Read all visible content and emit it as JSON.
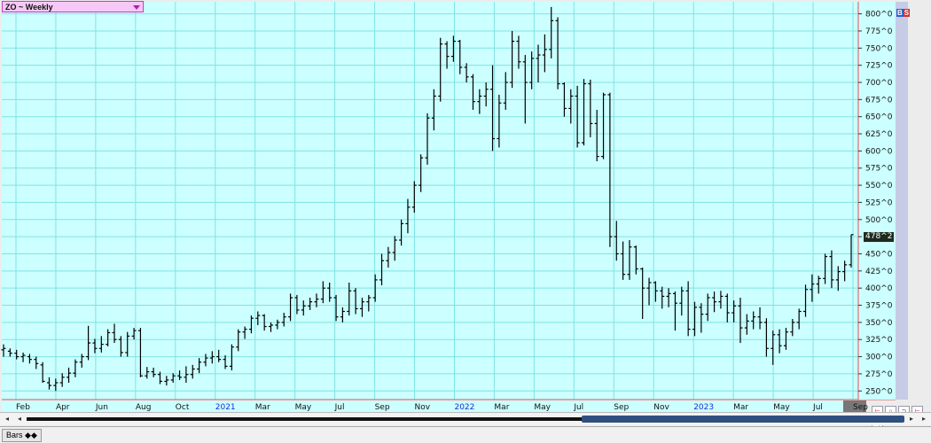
{
  "header": {
    "symbol_label": "ZO ~ Weekly"
  },
  "badges": {
    "b": "B",
    "s": "S"
  },
  "last_price_label": "478^2",
  "bottom": {
    "tab_label": "Bars",
    "tab_glyph": "◆◆"
  },
  "scroll": {
    "left_glyph": "◂",
    "left_glyph2": "◂",
    "right_glyph": "▸",
    "far_right_glyph": "▸"
  },
  "tools": [
    "⊢",
    "∩",
    "⊃",
    "⊢",
    "⊣"
  ],
  "colors": {
    "plot_bg": "#ccffff",
    "grid": "#7fe3e3",
    "bar": "#000000",
    "axis_line": "#e05050",
    "year_label": "#1a2fd0"
  },
  "chart_data": {
    "type": "ohlc",
    "series": [
      {
        "name": "ZO ~ Weekly",
        "values": []
      }
    ],
    "ylim": [
      240,
      815
    ],
    "y_ticks": [
      250,
      275,
      300,
      325,
      350,
      375,
      400,
      425,
      450,
      475,
      500,
      525,
      550,
      575,
      600,
      625,
      650,
      675,
      700,
      725,
      750,
      775,
      800
    ],
    "y_tick_labels": [
      "250^0",
      "275^0",
      "300^0",
      "325^0",
      "350^0",
      "375^0",
      "400^0",
      "425^0",
      "450^0",
      "475^0",
      "500^0",
      "525^0",
      "550^0",
      "575^0",
      "600^0",
      "625^0",
      "650^0",
      "675^0",
      "700^0",
      "725^0",
      "750^0",
      "775^0",
      "800^0"
    ],
    "x_labels": [
      {
        "label": "Feb",
        "year": false
      },
      {
        "label": "Apr",
        "year": false
      },
      {
        "label": "Jun",
        "year": false
      },
      {
        "label": "Aug",
        "year": false
      },
      {
        "label": "Oct",
        "year": false
      },
      {
        "label": "2021",
        "year": true
      },
      {
        "label": "Mar",
        "year": false
      },
      {
        "label": "May",
        "year": false
      },
      {
        "label": "Jul",
        "year": false
      },
      {
        "label": "Sep",
        "year": false
      },
      {
        "label": "Nov",
        "year": false
      },
      {
        "label": "2022",
        "year": true
      },
      {
        "label": "Mar",
        "year": false
      },
      {
        "label": "May",
        "year": false
      },
      {
        "label": "Jul",
        "year": false
      },
      {
        "label": "Sep",
        "year": false
      },
      {
        "label": "Nov",
        "year": false
      },
      {
        "label": "2023",
        "year": true
      },
      {
        "label": "Mar",
        "year": false
      },
      {
        "label": "May",
        "year": false
      },
      {
        "label": "Jul",
        "year": false
      },
      {
        "label": "Sep",
        "year": false
      }
    ],
    "bars": [
      [
        310,
        318,
        300,
        312
      ],
      [
        308,
        312,
        300,
        305
      ],
      [
        305,
        310,
        296,
        300
      ],
      [
        300,
        306,
        292,
        302
      ],
      [
        300,
        304,
        290,
        296
      ],
      [
        296,
        300,
        282,
        290
      ],
      [
        288,
        292,
        262,
        264
      ],
      [
        262,
        270,
        252,
        258
      ],
      [
        258,
        268,
        250,
        262
      ],
      [
        262,
        276,
        256,
        270
      ],
      [
        270,
        284,
        262,
        276
      ],
      [
        276,
        296,
        270,
        292
      ],
      [
        292,
        304,
        284,
        300
      ],
      [
        300,
        345,
        295,
        320
      ],
      [
        320,
        326,
        305,
        312
      ],
      [
        312,
        330,
        306,
        318
      ],
      [
        318,
        340,
        315,
        335
      ],
      [
        335,
        348,
        320,
        325
      ],
      [
        325,
        330,
        300,
        306
      ],
      [
        306,
        336,
        300,
        330
      ],
      [
        330,
        342,
        325,
        338
      ],
      [
        338,
        342,
        270,
        272
      ],
      [
        272,
        285,
        268,
        278
      ],
      [
        278,
        284,
        270,
        274
      ],
      [
        274,
        278,
        260,
        264
      ],
      [
        264,
        272,
        258,
        266
      ],
      [
        266,
        276,
        262,
        272
      ],
      [
        272,
        280,
        266,
        270
      ],
      [
        270,
        286,
        262,
        274
      ],
      [
        274,
        288,
        268,
        282
      ],
      [
        282,
        298,
        276,
        292
      ],
      [
        292,
        304,
        286,
        298
      ],
      [
        298,
        308,
        290,
        300
      ],
      [
        300,
        310,
        292,
        296
      ],
      [
        296,
        302,
        282,
        286
      ],
      [
        286,
        318,
        280,
        314
      ],
      [
        314,
        340,
        308,
        336
      ],
      [
        336,
        344,
        326,
        340
      ],
      [
        340,
        360,
        334,
        356
      ],
      [
        356,
        366,
        346,
        360
      ],
      [
        360,
        362,
        338,
        344
      ],
      [
        344,
        350,
        336,
        346
      ],
      [
        346,
        354,
        340,
        350
      ],
      [
        350,
        364,
        344,
        358
      ],
      [
        358,
        392,
        352,
        386
      ],
      [
        386,
        390,
        362,
        368
      ],
      [
        368,
        382,
        360,
        374
      ],
      [
        374,
        386,
        368,
        380
      ],
      [
        380,
        392,
        372,
        384
      ],
      [
        384,
        410,
        378,
        400
      ],
      [
        400,
        408,
        380,
        386
      ],
      [
        386,
        390,
        352,
        358
      ],
      [
        358,
        372,
        350,
        366
      ],
      [
        366,
        408,
        360,
        396
      ],
      [
        396,
        400,
        362,
        370
      ],
      [
        370,
        386,
        358,
        380
      ],
      [
        380,
        390,
        366,
        386
      ],
      [
        386,
        420,
        380,
        412
      ],
      [
        412,
        450,
        404,
        440
      ],
      [
        440,
        460,
        430,
        452
      ],
      [
        452,
        476,
        440,
        470
      ],
      [
        470,
        500,
        462,
        494
      ],
      [
        494,
        530,
        480,
        518
      ],
      [
        518,
        556,
        510,
        550
      ],
      [
        550,
        595,
        540,
        590
      ],
      [
        590,
        655,
        580,
        648
      ],
      [
        648,
        690,
        630,
        680
      ],
      [
        680,
        765,
        672,
        756
      ],
      [
        756,
        760,
        720,
        738
      ],
      [
        738,
        768,
        730,
        760
      ],
      [
        760,
        762,
        712,
        722
      ],
      [
        722,
        728,
        700,
        708
      ],
      [
        708,
        712,
        660,
        672
      ],
      [
        672,
        690,
        654,
        680
      ],
      [
        680,
        700,
        665,
        690
      ],
      [
        690,
        725,
        600,
        618
      ],
      [
        618,
        682,
        605,
        670
      ],
      [
        670,
        715,
        660,
        700
      ],
      [
        700,
        775,
        692,
        760
      ],
      [
        760,
        768,
        720,
        730
      ],
      [
        730,
        740,
        640,
        700
      ],
      [
        700,
        745,
        690,
        735
      ],
      [
        735,
        755,
        700,
        740
      ],
      [
        740,
        770,
        715,
        748
      ],
      [
        748,
        810,
        735,
        790
      ],
      [
        790,
        795,
        690,
        698
      ],
      [
        698,
        700,
        650,
        662
      ],
      [
        662,
        690,
        640,
        680
      ],
      [
        680,
        695,
        605,
        612
      ],
      [
        612,
        705,
        608,
        698
      ],
      [
        698,
        704,
        620,
        640
      ],
      [
        640,
        660,
        585,
        592
      ],
      [
        592,
        685,
        588,
        682
      ],
      [
        682,
        685,
        460,
        475
      ],
      [
        475,
        498,
        440,
        450
      ],
      [
        450,
        468,
        412,
        420
      ],
      [
        420,
        470,
        412,
        460
      ],
      [
        460,
        462,
        420,
        428
      ],
      [
        428,
        430,
        355,
        400
      ],
      [
        400,
        415,
        375,
        408
      ],
      [
        408,
        410,
        380,
        396
      ],
      [
        396,
        402,
        370,
        388
      ],
      [
        388,
        400,
        372,
        392
      ],
      [
        392,
        395,
        338,
        378
      ],
      [
        378,
        402,
        360,
        396
      ],
      [
        396,
        410,
        330,
        340
      ],
      [
        340,
        380,
        330,
        372
      ],
      [
        372,
        378,
        335,
        362
      ],
      [
        362,
        392,
        352,
        386
      ],
      [
        386,
        395,
        365,
        380
      ],
      [
        380,
        396,
        370,
        388
      ],
      [
        388,
        392,
        350,
        364
      ],
      [
        364,
        382,
        350,
        374
      ],
      [
        374,
        386,
        320,
        342
      ],
      [
        342,
        362,
        332,
        352
      ],
      [
        352,
        366,
        340,
        358
      ],
      [
        358,
        372,
        340,
        350
      ],
      [
        350,
        356,
        300,
        312
      ],
      [
        312,
        338,
        288,
        332
      ],
      [
        332,
        340,
        305,
        316
      ],
      [
        316,
        342,
        310,
        336
      ],
      [
        336,
        355,
        330,
        350
      ],
      [
        350,
        370,
        340,
        366
      ],
      [
        366,
        405,
        358,
        398
      ],
      [
        398,
        420,
        380,
        406
      ],
      [
        406,
        418,
        392,
        414
      ],
      [
        414,
        450,
        406,
        446
      ],
      [
        446,
        455,
        400,
        412
      ],
      [
        412,
        432,
        396,
        424
      ],
      [
        424,
        440,
        410,
        434
      ],
      [
        434,
        478,
        430,
        478
      ]
    ]
  }
}
